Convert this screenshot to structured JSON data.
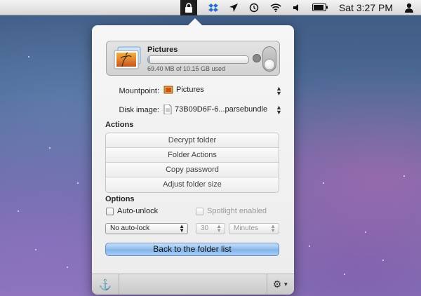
{
  "menubar": {
    "clock": "Sat 3:27 PM",
    "icons": [
      "lock-icon",
      "dropbox-icon",
      "location-icon",
      "time-machine-icon",
      "wifi-icon",
      "volume-icon",
      "battery-icon",
      "user-icon"
    ]
  },
  "disk": {
    "name": "Pictures",
    "usage_text": "69.40 MB of 10.15 GB used",
    "used_fraction": 0.0068
  },
  "mountpoint": {
    "label": "Mountpoint:",
    "value": "Pictures"
  },
  "disk_image": {
    "label": "Disk image:",
    "value": "73B09D6F-6...parsebundle"
  },
  "actions": {
    "title": "Actions",
    "items": [
      "Decrypt folder",
      "Folder Actions",
      "Copy password",
      "Adjust folder size"
    ]
  },
  "options": {
    "title": "Options",
    "auto_unlock": "Auto-unlock",
    "spotlight": "Spotlight enabled",
    "autolock_select": "No auto-lock",
    "interval_value": "30",
    "interval_unit": "Minutes"
  },
  "back_button": "Back to the folder list",
  "footer": {
    "anchor_icon": "anchor-icon",
    "gear_icon": "gear-icon"
  }
}
